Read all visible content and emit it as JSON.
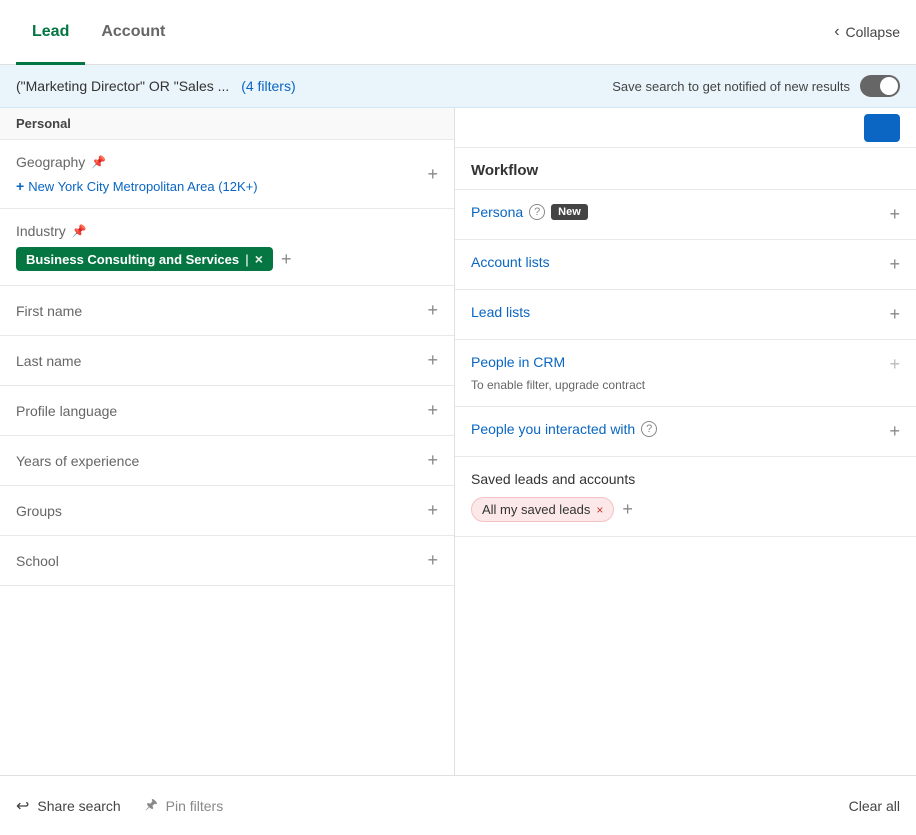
{
  "tabs": [
    {
      "id": "lead",
      "label": "Lead",
      "active": true
    },
    {
      "id": "account",
      "label": "Account",
      "active": false
    }
  ],
  "collapse": {
    "label": "Collapse"
  },
  "search": {
    "query": "(\"Marketing Director\" OR \"Sales ...",
    "filter_count": "(4 filters)",
    "save_label": "Save search to get notified of new results"
  },
  "personal_label": "Personal",
  "filters": [
    {
      "id": "geography",
      "label": "Geography",
      "pinned": true,
      "value_link": "New York City Metropolitan Area (12K+)",
      "has_value": true
    },
    {
      "id": "industry",
      "label": "Industry",
      "pinned": true,
      "tag": "Business Consulting and Services",
      "has_tag": true
    },
    {
      "id": "first_name",
      "label": "First name",
      "pinned": false
    },
    {
      "id": "last_name",
      "label": "Last name",
      "pinned": false
    },
    {
      "id": "profile_language",
      "label": "Profile language",
      "pinned": false
    },
    {
      "id": "years_of_experience",
      "label": "Years of experience",
      "pinned": false
    },
    {
      "id": "groups",
      "label": "Groups",
      "pinned": false
    },
    {
      "id": "school",
      "label": "School",
      "pinned": false
    }
  ],
  "workflow": {
    "header": "Workflow",
    "items": [
      {
        "id": "persona",
        "label": "Persona",
        "has_help": true,
        "has_new_badge": true,
        "new_label": "New"
      },
      {
        "id": "account_lists",
        "label": "Account lists",
        "has_help": false
      },
      {
        "id": "lead_lists",
        "label": "Lead lists",
        "has_help": false
      },
      {
        "id": "people_in_crm",
        "label": "People in CRM",
        "has_help": false,
        "upgrade_note": "To enable filter, upgrade contract"
      },
      {
        "id": "people_interacted",
        "label": "People you interacted with",
        "has_help": true
      }
    ]
  },
  "saved": {
    "title": "Saved leads and accounts",
    "tags": [
      {
        "label": "All my saved leads"
      }
    ],
    "add_label": "+"
  },
  "bottom_bar": {
    "share_label": "Share search",
    "pin_label": "Pin filters",
    "clear_label": "Clear all"
  },
  "icons": {
    "share": "↩",
    "pin": "📌",
    "chevron_left": "‹",
    "plus": "+",
    "pin_small": "🖈",
    "question": "?",
    "x": "×"
  }
}
